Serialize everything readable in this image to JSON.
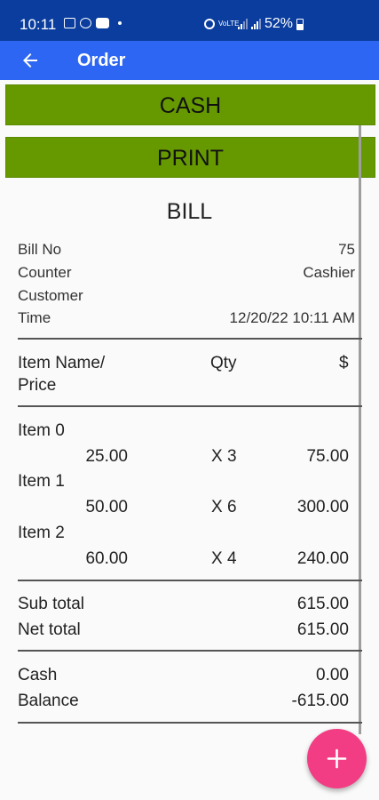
{
  "status": {
    "time": "10:11",
    "battery": "52%",
    "volte": "VoLTE"
  },
  "appbar": {
    "title": "Order"
  },
  "buttons": {
    "cash": "CASH",
    "print": "PRINT"
  },
  "bill": {
    "title": "BILL",
    "info": [
      {
        "label": "Bill No",
        "value": "75"
      },
      {
        "label": "Counter",
        "value": "Cashier"
      },
      {
        "label": "Customer",
        "value": ""
      },
      {
        "label": "Time",
        "value": "12/20/22 10:11 AM"
      }
    ],
    "headers": {
      "item": "Item Name/",
      "item2": "Price",
      "qty": "Qty",
      "amount": "$"
    },
    "items": [
      {
        "name": "Item 0",
        "price": "25.00",
        "qty": "X 3",
        "total": "75.00"
      },
      {
        "name": "Item 1",
        "price": "50.00",
        "qty": "X 6",
        "total": "300.00"
      },
      {
        "name": "Item 2",
        "price": "60.00",
        "qty": "X 4",
        "total": "240.00"
      }
    ],
    "subtotal": {
      "label": "Sub total",
      "value": "615.00"
    },
    "nettotal": {
      "label": "Net total",
      "value": "615.00"
    },
    "cash": {
      "label": "Cash",
      "value": "0.00"
    },
    "balance": {
      "label": "Balance",
      "value": "-615.00"
    }
  }
}
